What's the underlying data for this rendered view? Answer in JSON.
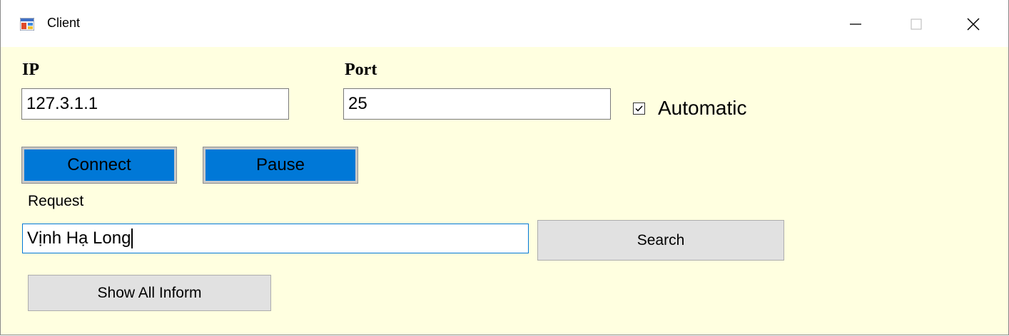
{
  "window": {
    "title": "Client",
    "minimize_glyph": "—",
    "maximize_glyph": "☐",
    "close_glyph": "✕"
  },
  "form": {
    "ip_label": "IP",
    "ip_value": "127.3.1.1",
    "port_label": "Port",
    "port_value": "25",
    "automatic_label": "Automatic",
    "automatic_checked": true,
    "connect_label": "Connect",
    "pause_label": "Pause",
    "request_label": "Request",
    "request_value": "Vịnh Hạ Long",
    "search_label": "Search",
    "show_all_label": "Show All Inform"
  },
  "colors": {
    "client_background": "#ffffe0",
    "button_blue": "#0078d7",
    "button_gray": "#e1e1e1",
    "focus_border": "#0078d7"
  },
  "icons": [
    "app-window-icon",
    "minimize-icon",
    "maximize-icon",
    "close-icon",
    "checkmark-icon"
  ]
}
